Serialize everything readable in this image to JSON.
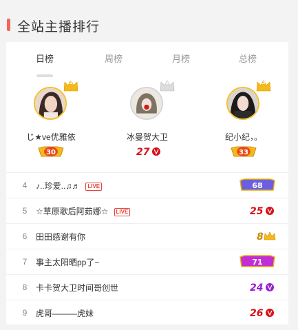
{
  "section": {
    "title": "全站主播排行"
  },
  "tabs": [
    {
      "label": "日榜",
      "active": true
    },
    {
      "label": "周榜",
      "active": false
    },
    {
      "label": "月榜",
      "active": false
    },
    {
      "label": "总榜",
      "active": false
    }
  ],
  "top3": [
    {
      "rank": "1",
      "name": "じ★ve优雅依",
      "level": "30"
    },
    {
      "rank": "2",
      "name": "冰曼贺大卫",
      "level": "27"
    },
    {
      "rank": "3",
      "name": "纪小纪，。",
      "level": "33"
    }
  ],
  "list": [
    {
      "rank": "4",
      "name": "♪..珍爱..♫♬",
      "live": "LIVE",
      "level": "68"
    },
    {
      "rank": "5",
      "name": "☆草原歌后阿茹娜☆",
      "live": "LIVE",
      "level": "25"
    },
    {
      "rank": "6",
      "name": "田田感谢有你",
      "live": "",
      "level": "8"
    },
    {
      "rank": "7",
      "name": "事主太阳晒pp了~",
      "live": "",
      "level": "71"
    },
    {
      "rank": "8",
      "name": "卡卡贺大卫时间哥创世",
      "live": "",
      "level": "24"
    },
    {
      "rank": "9",
      "name": "虎哥———虎妹",
      "live": "",
      "level": "26"
    }
  ],
  "colors": {
    "accent": "#f0675a",
    "gold": "#f3c230",
    "live": "#e8453c",
    "level_red": "#d8121a",
    "level_purple": "#9a1fd1",
    "level_gold": "#c98a00"
  },
  "icons": {
    "crown": "crown-icon",
    "level": "level-badge-icon"
  }
}
